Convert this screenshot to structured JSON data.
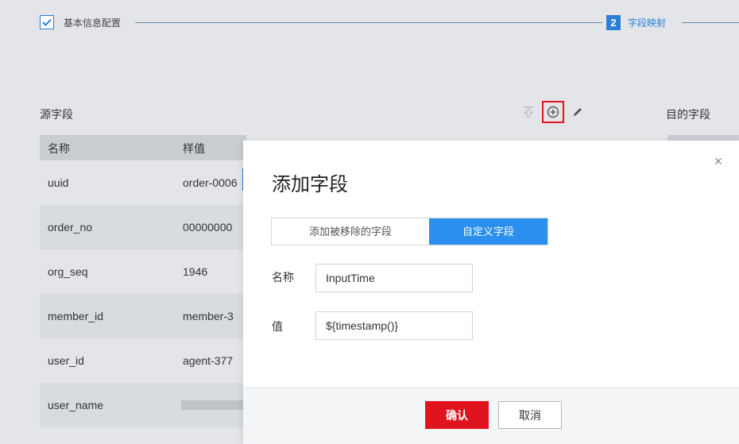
{
  "stepper": {
    "step1_label": "基本信息配置",
    "step2_number": "2",
    "step2_label": "字段映射"
  },
  "source": {
    "title": "源字段",
    "columns": [
      "名称",
      "样值"
    ],
    "rows": [
      {
        "name": "uuid",
        "sample": "order-0006"
      },
      {
        "name": "order_no",
        "sample": "00000000"
      },
      {
        "name": "org_seq",
        "sample": "1946"
      },
      {
        "name": "member_id",
        "sample": "member-3"
      },
      {
        "name": "user_id",
        "sample": "agent-377"
      },
      {
        "name": "user_name",
        "sample": ""
      }
    ]
  },
  "destination": {
    "title": "目的字段"
  },
  "toolbar": {
    "icons": [
      "move-top-icon",
      "add-circle-icon",
      "edit-pencil-icon"
    ]
  },
  "dialog": {
    "title": "添加字段",
    "close": "×",
    "tabs": [
      {
        "label": "添加被移除的字段",
        "active": false
      },
      {
        "label": "自定义字段",
        "active": true
      }
    ],
    "name_label": "名称",
    "name_value": "InputTime",
    "value_label": "值",
    "value_value": "${timestamp()}",
    "confirm": "确认",
    "cancel": "取消"
  },
  "colors": {
    "accent": "#2b8ff0",
    "danger": "#e0141e"
  }
}
